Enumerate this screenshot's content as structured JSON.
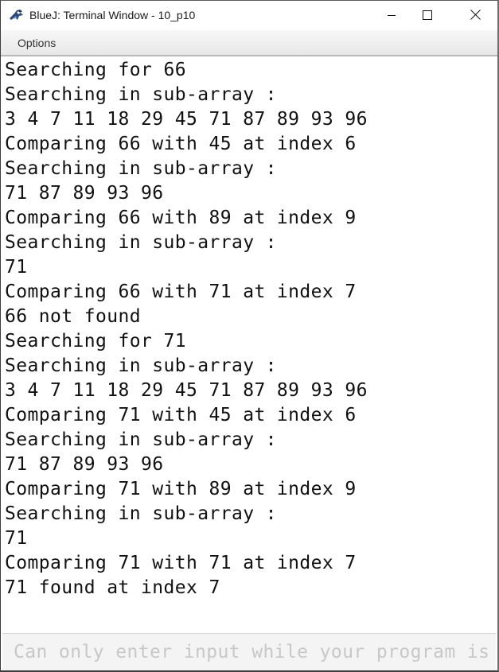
{
  "window": {
    "title": "BlueJ: Terminal Window - 10_p10",
    "app_icon": "bluej-bird-icon",
    "controls": {
      "minimize_icon": "minimize-icon",
      "maximize_icon": "maximize-icon",
      "close_icon": "close-icon"
    }
  },
  "menubar": {
    "items": [
      {
        "label": "Options"
      }
    ]
  },
  "terminal": {
    "lines": [
      "Searching for 66",
      "Searching in sub-array :",
      "3 4 7 11 18 29 45 71 87 89 93 96",
      "Comparing 66 with 45 at index 6",
      "Searching in sub-array :",
      "71 87 89 93 96",
      "Comparing 66 with 89 at index 9",
      "Searching in sub-array :",
      "71",
      "Comparing 66 with 71 at index 7",
      "66 not found",
      "Searching for 71",
      "Searching in sub-array :",
      "3 4 7 11 18 29 45 71 87 89 93 96",
      "Comparing 71 with 45 at index 6",
      "Searching in sub-array :",
      "71 87 89 93 96",
      "Comparing 71 with 89 at index 9",
      "Searching in sub-array :",
      "71",
      "Comparing 71 with 71 at index 7",
      "71 found at index 7"
    ]
  },
  "input": {
    "placeholder": "Can only enter input while your program is running",
    "value": ""
  },
  "colors": {
    "text": "#111111",
    "placeholder": "#c8c8c8",
    "menubar_bg": "#eeeeee",
    "input_bg": "#f4f4f4"
  }
}
